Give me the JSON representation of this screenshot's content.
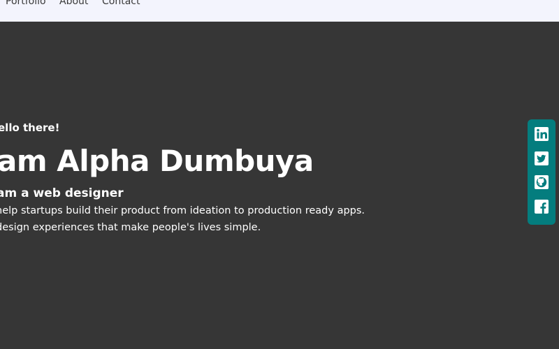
{
  "nav": {
    "items": [
      "Portfolio",
      "About",
      "Contact"
    ]
  },
  "hero": {
    "greeting": "ello there!",
    "headline": "am Alpha Dumbuya",
    "role": "am a web designer",
    "tagline_1": "help startups build their product from ideation to production ready apps.",
    "tagline_2": "design experiences that make people's lives simple."
  },
  "social": {
    "icons": [
      "linkedin-icon",
      "twitter-icon",
      "github-icon",
      "facebook-icon"
    ]
  },
  "colors": {
    "page_background": "#363636",
    "navbar_background": "#f3f4fd",
    "social_bar": "#047d7e",
    "text": "#ffffff"
  }
}
